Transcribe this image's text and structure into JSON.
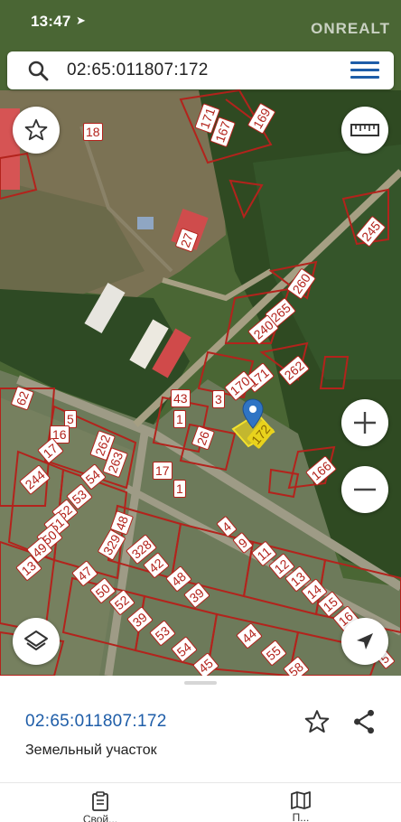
{
  "status_bar": {
    "time": "13:47",
    "location_glyph": "➤",
    "watermark": "ONREALT"
  },
  "search": {
    "value": "02:65:011807:172",
    "icon": "search-icon"
  },
  "map": {
    "parcel_labels": [
      "171",
      "167",
      "169",
      "18",
      "27",
      "245",
      "260",
      "265",
      "240",
      "262",
      "171",
      "170",
      "3",
      "1",
      "26",
      "172",
      "166",
      "62",
      "5",
      "16",
      "17",
      "262",
      "263",
      "244",
      "54",
      "53",
      "52",
      "51",
      "50",
      "49",
      "13",
      "48",
      "329",
      "328",
      "42",
      "48",
      "47",
      "50",
      "39",
      "52",
      "39",
      "53",
      "54",
      "55",
      "44",
      "45",
      "58",
      "43",
      "1",
      "4",
      "9",
      "11",
      "12",
      "13",
      "14",
      "15",
      "16",
      "17",
      "5",
      "20"
    ],
    "highlighted_parcel": "172",
    "accent_color": "#e8d21c",
    "boundary_color": "#b3231c"
  },
  "controls": {
    "favorite_icon": "star-icon",
    "measure_icon": "ruler-icon",
    "zoom_in_icon": "plus-icon",
    "zoom_out_icon": "minus-icon",
    "layers_icon": "layers-icon",
    "locate_icon": "location-arrow-icon"
  },
  "sheet": {
    "parcel_id": "02:65:011807:172",
    "parcel_type": "Земельный участок",
    "tabs": [
      {
        "icon": "clipboard-icon",
        "label": "Свой..."
      },
      {
        "icon": "map-icon",
        "label": "П..."
      }
    ]
  }
}
